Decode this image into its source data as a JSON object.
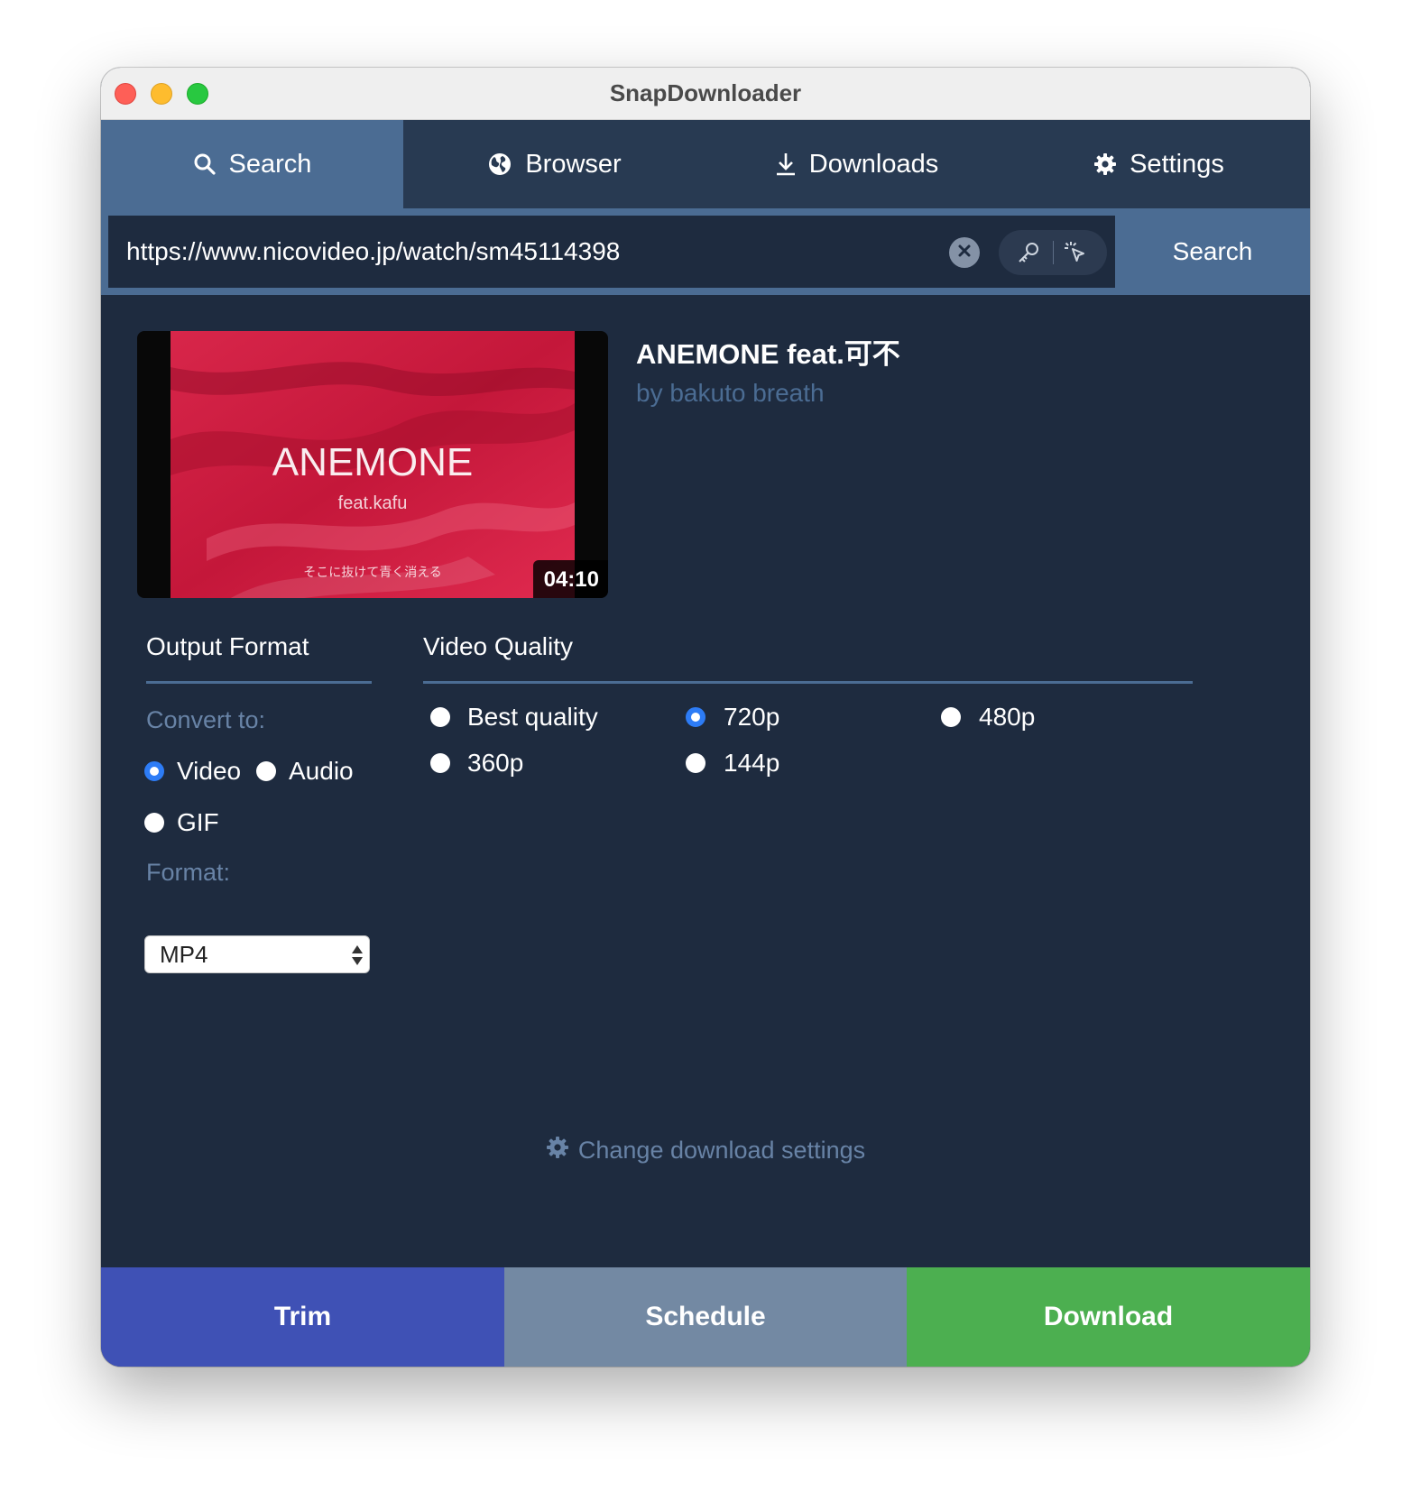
{
  "window": {
    "title": "SnapDownloader"
  },
  "tabs": [
    {
      "label": "Search",
      "icon": "search-icon",
      "active": true
    },
    {
      "label": "Browser",
      "icon": "globe-icon",
      "active": false
    },
    {
      "label": "Downloads",
      "icon": "download-icon",
      "active": false
    },
    {
      "label": "Settings",
      "icon": "gear-icon",
      "active": false
    }
  ],
  "search": {
    "url": "https://www.nicovideo.jp/watch/sm45114398",
    "button_label": "Search"
  },
  "video": {
    "title": "ANEMONE feat.可不",
    "author": "by bakuto breath",
    "duration": "04:10",
    "thumbnail_title": "ANEMONE",
    "thumbnail_subtitle": "feat.kafu",
    "thumbnail_caption": "そこに抜けて青く消える"
  },
  "output_format": {
    "heading": "Output Format",
    "convert_label": "Convert to:",
    "options": [
      {
        "label": "Video",
        "checked": true
      },
      {
        "label": "Audio",
        "checked": false
      },
      {
        "label": "GIF",
        "checked": false
      }
    ],
    "format_label": "Format:",
    "format_value": "MP4"
  },
  "video_quality": {
    "heading": "Video Quality",
    "options": [
      {
        "label": "Best quality",
        "checked": false
      },
      {
        "label": "720p",
        "checked": true
      },
      {
        "label": "480p",
        "checked": false
      },
      {
        "label": "360p",
        "checked": false
      },
      {
        "label": "144p",
        "checked": false
      }
    ]
  },
  "change_settings_label": "Change download settings",
  "actions": {
    "trim": "Trim",
    "schedule": "Schedule",
    "download": "Download"
  },
  "colors": {
    "window_bg": "#1e2b3f",
    "tab_bar": "#283a52",
    "accent": "#4b6c93",
    "radio_checked": "#2d7cf6",
    "trim": "#3f51b5",
    "schedule": "#7389a3",
    "download": "#4caf50"
  }
}
